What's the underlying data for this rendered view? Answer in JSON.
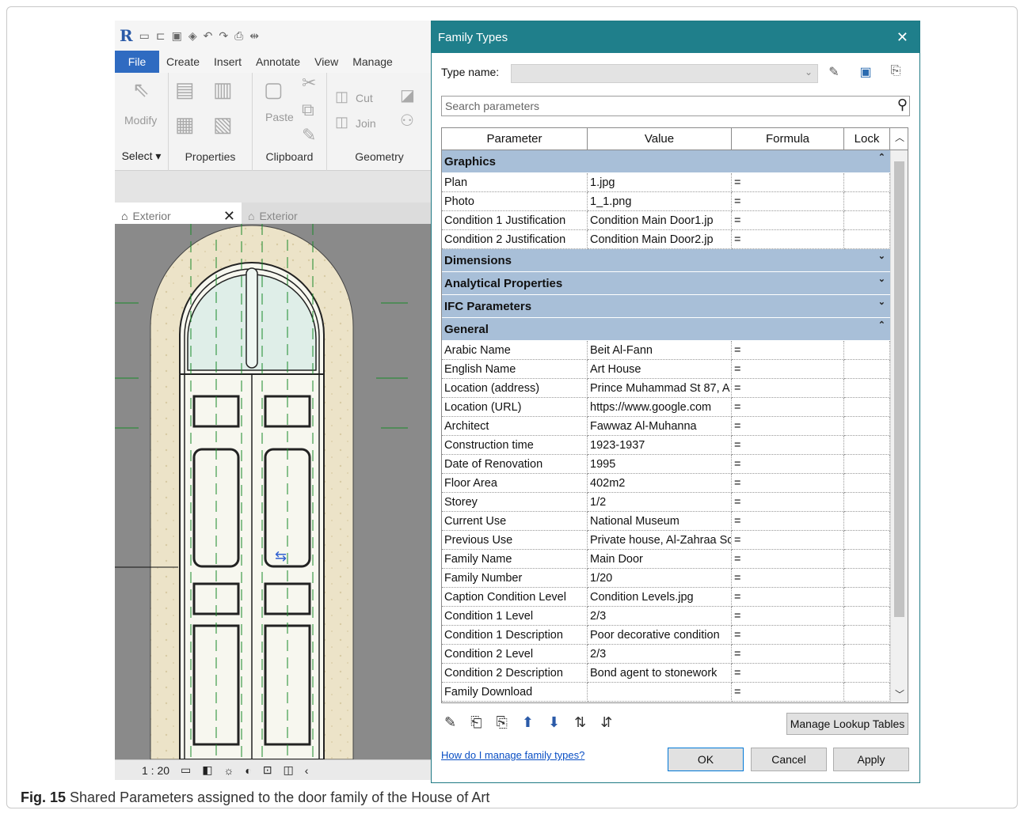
{
  "app": {
    "tabs": [
      "File",
      "Create",
      "Insert",
      "Annotate",
      "View",
      "Manage"
    ],
    "panels": {
      "modify": "Modify",
      "select": "Select ▾",
      "properties": "Properties",
      "clipboard": "Clipboard",
      "paste": "Paste",
      "geometry": "Geometry",
      "cut": "Cut",
      "join": "Join"
    },
    "view_tabs": [
      "Exterior",
      "Exterior"
    ],
    "scale": "1 : 20"
  },
  "dialog": {
    "title": "Family Types",
    "type_name_label": "Type name:",
    "search_placeholder": "Search parameters",
    "columns": [
      "Parameter",
      "Value",
      "Formula",
      "Lock"
    ],
    "groups": [
      {
        "name": "Graphics",
        "expanded": true,
        "rows": [
          {
            "param": "Plan",
            "value": "1.jpg",
            "formula": "="
          },
          {
            "param": "Photo",
            "value": "1_1.png",
            "formula": "="
          },
          {
            "param": "Condition 1 Justification",
            "value": "Condition Main Door1.jp",
            "formula": "="
          },
          {
            "param": "Condition 2 Justification",
            "value": "Condition Main Door2.jp",
            "formula": "="
          }
        ]
      },
      {
        "name": "Dimensions",
        "expanded": false,
        "rows": []
      },
      {
        "name": "Analytical Properties",
        "expanded": false,
        "rows": []
      },
      {
        "name": "IFC Parameters",
        "expanded": false,
        "rows": []
      },
      {
        "name": "General",
        "expanded": true,
        "rows": [
          {
            "param": "Arabic Name",
            "value": "Beit Al-Fann",
            "formula": "="
          },
          {
            "param": "English Name",
            "value": "Art House",
            "formula": "="
          },
          {
            "param": "Location (address)",
            "value": "Prince Muhammad St 87, A",
            "formula": "="
          },
          {
            "param": "Location (URL)",
            "value": "https://www.google.com",
            "formula": "="
          },
          {
            "param": "Architect",
            "value": "Fawwaz Al-Muhanna",
            "formula": "="
          },
          {
            "param": "Construction time",
            "value": "1923-1937",
            "formula": "="
          },
          {
            "param": "Date of Renovation",
            "value": "1995",
            "formula": "="
          },
          {
            "param": "Floor Area",
            "value": "402m2",
            "formula": "="
          },
          {
            "param": "Storey",
            "value": "1/2",
            "formula": "="
          },
          {
            "param": "Current Use",
            "value": "National Museum",
            "formula": "="
          },
          {
            "param": "Previous Use",
            "value": "Private house, Al-Zahraa Sc",
            "formula": "="
          },
          {
            "param": "Family Name",
            "value": "Main Door",
            "formula": "="
          },
          {
            "param": "Family Number",
            "value": "1/20",
            "formula": "="
          },
          {
            "param": "Caption Condition Level",
            "value": "Condition Levels.jpg",
            "formula": "="
          },
          {
            "param": "Condition 1 Level",
            "value": "2/3",
            "formula": "="
          },
          {
            "param": "Condition 1 Description",
            "value": "Poor decorative condition",
            "formula": "="
          },
          {
            "param": "Condition 2 Level",
            "value": "2/3",
            "formula": "="
          },
          {
            "param": "Condition 2 Description",
            "value": "Bond agent to stonework",
            "formula": "="
          },
          {
            "param": "Family Download",
            "value": "",
            "formula": "="
          }
        ]
      }
    ],
    "manage_lookup": "Manage Lookup Tables",
    "help_link": "How do I manage family types?",
    "ok": "OK",
    "cancel": "Cancel",
    "apply": "Apply"
  },
  "caption": {
    "label": "Fig. 15",
    "text": "Shared Parameters assigned to the door family of the House of Art"
  },
  "colors": {
    "title_bar": "#1f7f8b",
    "group_header": "#a8bfd8",
    "file_tab": "#2f6bc1"
  }
}
